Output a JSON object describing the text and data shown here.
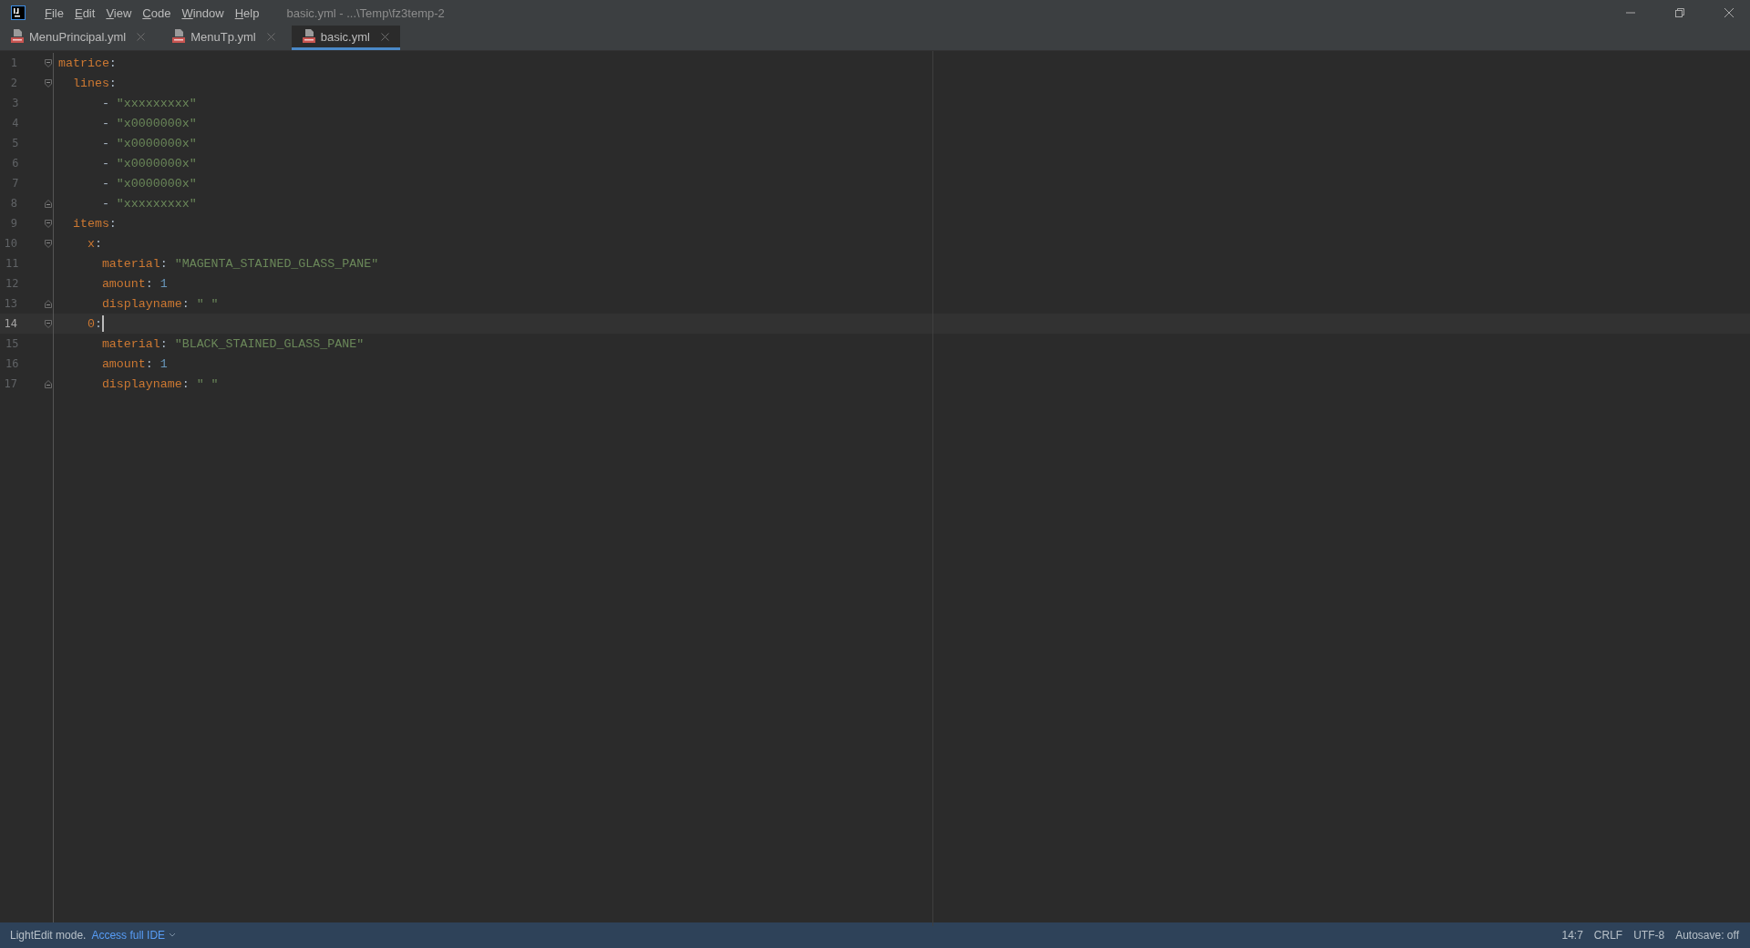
{
  "window": {
    "title": "basic.yml - ...\\Temp\\fz3temp-2"
  },
  "menu": [
    "File",
    "Edit",
    "View",
    "Code",
    "Window",
    "Help"
  ],
  "tabs": [
    {
      "label": "MenuPrincipal.yml",
      "selected": false
    },
    {
      "label": "MenuTp.yml",
      "selected": false
    },
    {
      "label": "basic.yml",
      "selected": true
    }
  ],
  "editor": {
    "lines": [
      {
        "number": "1",
        "fold_start": true,
        "fold_end": false,
        "current": false,
        "caret": false,
        "tokens": [
          {
            "kind": "key",
            "text": "matrice"
          },
          {
            "kind": "punct",
            "text": ":"
          }
        ]
      },
      {
        "number": "2",
        "fold_start": true,
        "fold_end": false,
        "current": false,
        "caret": false,
        "tokens": [
          {
            "kind": "key",
            "text": "  lines"
          },
          {
            "kind": "punct",
            "text": ":"
          }
        ]
      },
      {
        "number": "3",
        "fold_start": false,
        "fold_end": false,
        "current": false,
        "caret": false,
        "tokens": [
          {
            "kind": "punct",
            "text": "      - "
          },
          {
            "kind": "string",
            "text": "\"xxxxxxxxx\""
          }
        ]
      },
      {
        "number": "4",
        "fold_start": false,
        "fold_end": false,
        "current": false,
        "caret": false,
        "tokens": [
          {
            "kind": "punct",
            "text": "      - "
          },
          {
            "kind": "string",
            "text": "\"x0000000x\""
          }
        ]
      },
      {
        "number": "5",
        "fold_start": false,
        "fold_end": false,
        "current": false,
        "caret": false,
        "tokens": [
          {
            "kind": "punct",
            "text": "      - "
          },
          {
            "kind": "string",
            "text": "\"x0000000x\""
          }
        ]
      },
      {
        "number": "6",
        "fold_start": false,
        "fold_end": false,
        "current": false,
        "caret": false,
        "tokens": [
          {
            "kind": "punct",
            "text": "      - "
          },
          {
            "kind": "string",
            "text": "\"x0000000x\""
          }
        ]
      },
      {
        "number": "7",
        "fold_start": false,
        "fold_end": false,
        "current": false,
        "caret": false,
        "tokens": [
          {
            "kind": "punct",
            "text": "      - "
          },
          {
            "kind": "string",
            "text": "\"x0000000x\""
          }
        ]
      },
      {
        "number": "8",
        "fold_start": false,
        "fold_end": true,
        "current": false,
        "caret": false,
        "tokens": [
          {
            "kind": "punct",
            "text": "      - "
          },
          {
            "kind": "string",
            "text": "\"xxxxxxxxx\""
          }
        ]
      },
      {
        "number": "9",
        "fold_start": true,
        "fold_end": false,
        "current": false,
        "caret": false,
        "tokens": [
          {
            "kind": "key",
            "text": "  items"
          },
          {
            "kind": "punct",
            "text": ":"
          }
        ]
      },
      {
        "number": "10",
        "fold_start": true,
        "fold_end": false,
        "current": false,
        "caret": false,
        "tokens": [
          {
            "kind": "key",
            "text": "    x"
          },
          {
            "kind": "punct",
            "text": ":"
          }
        ]
      },
      {
        "number": "11",
        "fold_start": false,
        "fold_end": false,
        "current": false,
        "caret": false,
        "tokens": [
          {
            "kind": "key",
            "text": "      material"
          },
          {
            "kind": "punct",
            "text": ": "
          },
          {
            "kind": "string",
            "text": "\"MAGENTA_STAINED_GLASS_PANE\""
          }
        ]
      },
      {
        "number": "12",
        "fold_start": false,
        "fold_end": false,
        "current": false,
        "caret": false,
        "tokens": [
          {
            "kind": "key",
            "text": "      amount"
          },
          {
            "kind": "punct",
            "text": ": "
          },
          {
            "kind": "number",
            "text": "1"
          }
        ]
      },
      {
        "number": "13",
        "fold_start": false,
        "fold_end": true,
        "current": false,
        "caret": false,
        "tokens": [
          {
            "kind": "key",
            "text": "      displayname"
          },
          {
            "kind": "punct",
            "text": ": "
          },
          {
            "kind": "string",
            "text": "\" \""
          }
        ]
      },
      {
        "number": "14",
        "fold_start": true,
        "fold_end": false,
        "current": true,
        "caret": true,
        "tokens": [
          {
            "kind": "key",
            "text": "    0"
          },
          {
            "kind": "punct",
            "text": ":"
          }
        ]
      },
      {
        "number": "15",
        "fold_start": false,
        "fold_end": false,
        "current": false,
        "caret": false,
        "tokens": [
          {
            "kind": "key",
            "text": "      material"
          },
          {
            "kind": "punct",
            "text": ": "
          },
          {
            "kind": "string",
            "text": "\"BLACK_STAINED_GLASS_PANE\""
          }
        ]
      },
      {
        "number": "16",
        "fold_start": false,
        "fold_end": false,
        "current": false,
        "caret": false,
        "tokens": [
          {
            "kind": "key",
            "text": "      amount"
          },
          {
            "kind": "punct",
            "text": ": "
          },
          {
            "kind": "number",
            "text": "1"
          }
        ]
      },
      {
        "number": "17",
        "fold_start": false,
        "fold_end": true,
        "current": false,
        "caret": false,
        "tokens": [
          {
            "kind": "key",
            "text": "      displayname"
          },
          {
            "kind": "punct",
            "text": ": "
          },
          {
            "kind": "string",
            "text": "\" \""
          }
        ]
      }
    ]
  },
  "status_bar": {
    "mode": "LightEdit mode.",
    "link": "Access full IDE",
    "items": [
      "14:7",
      "CRLF",
      "UTF-8",
      "Autosave: off"
    ]
  }
}
